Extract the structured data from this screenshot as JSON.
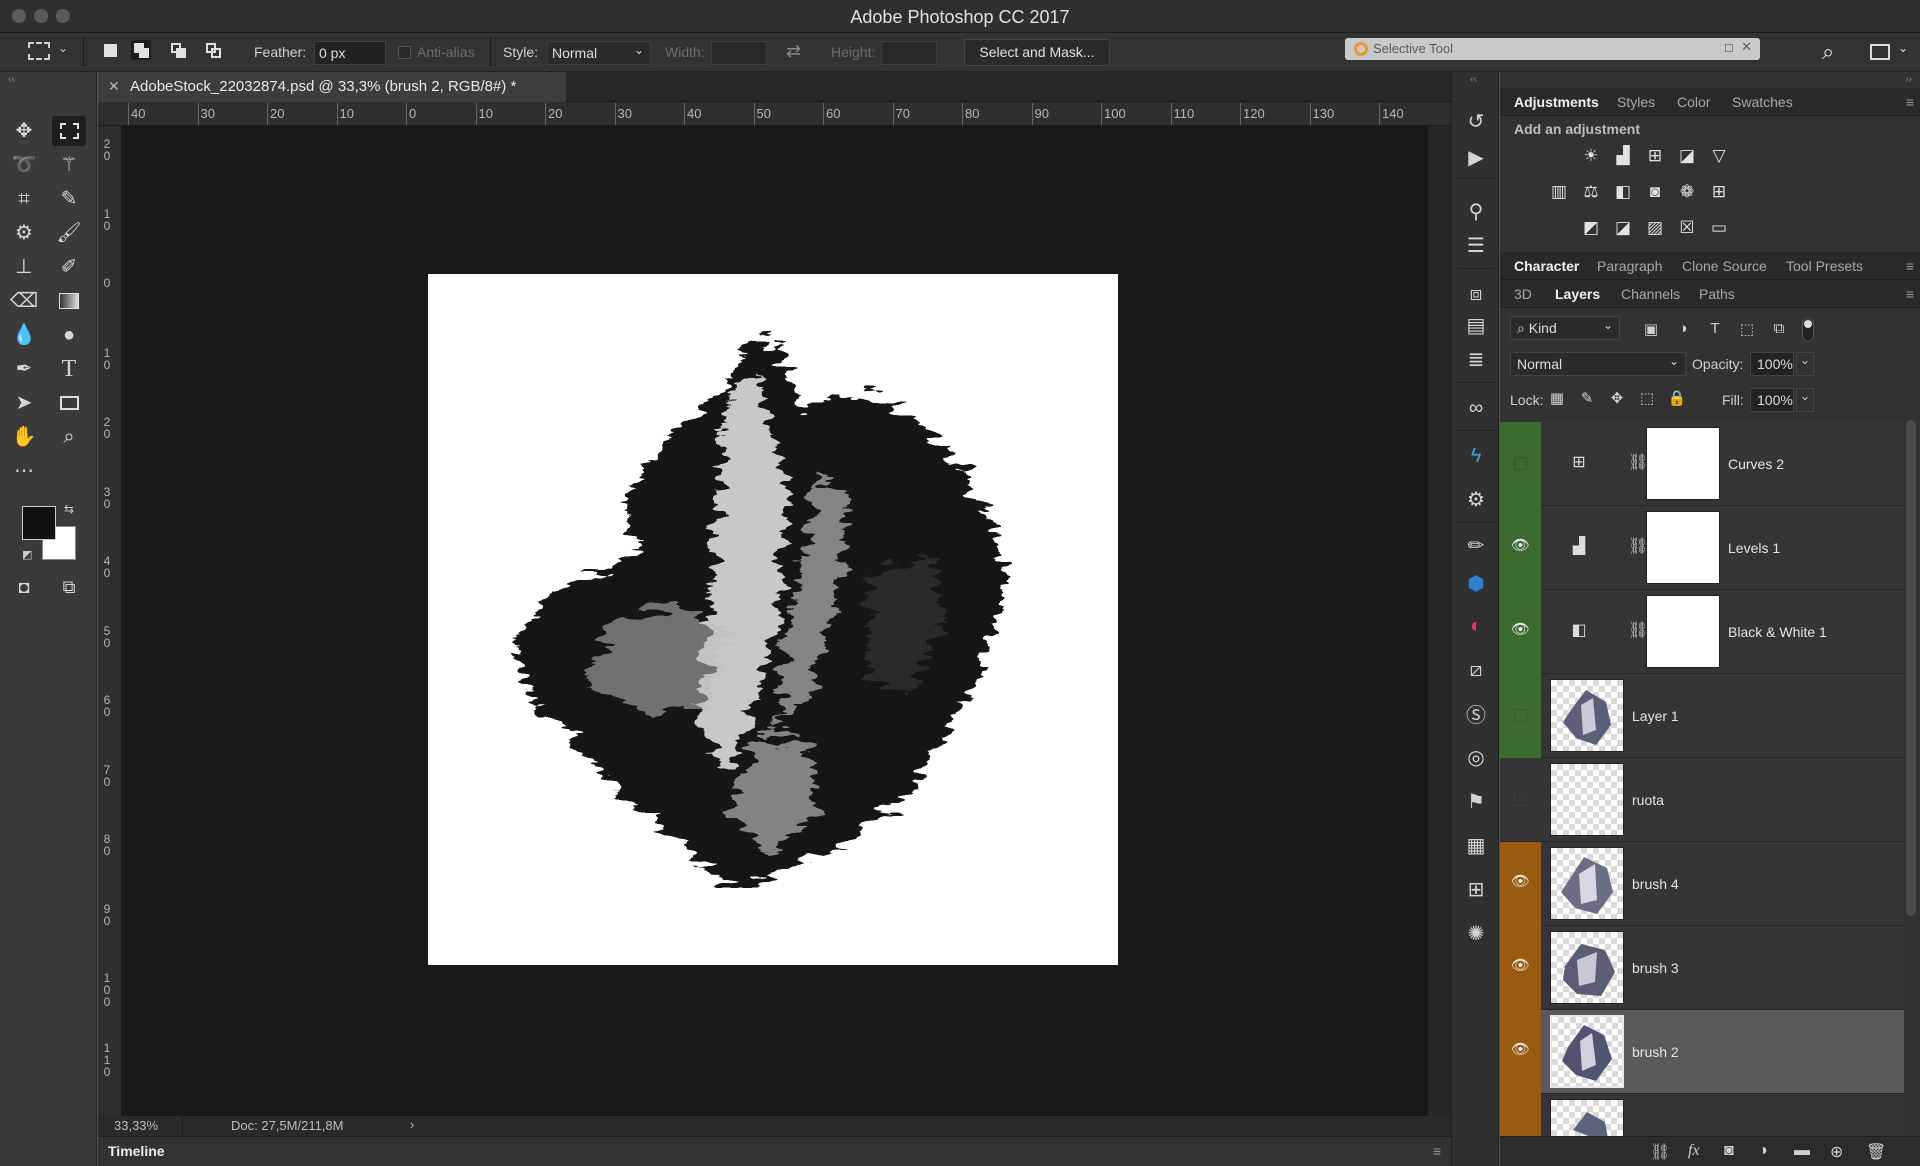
{
  "window": {
    "title": "Adobe Photoshop CC 2017"
  },
  "options_bar": {
    "feather_label": "Feather:",
    "feather_value": "0 px",
    "anti_alias_label": "Anti-alias",
    "style_label": "Style:",
    "style_value": "Normal",
    "width_label": "Width:",
    "height_label": "Height:",
    "select_mask_label": "Select and Mask...",
    "selective_tool_label": "Selective Tool"
  },
  "document": {
    "tab_title": "AdobeStock_22032874.psd @ 33,3% (brush 2, RGB/8#) *",
    "zoom": "33,33%",
    "doc_info": "Doc: 27,5M/211,8M",
    "ruler_top": [
      "40",
      "30",
      "20",
      "10",
      "0",
      "10",
      "20",
      "30",
      "40",
      "50",
      "60",
      "70",
      "80",
      "90",
      "100",
      "110",
      "120",
      "130",
      "140"
    ],
    "ruler_left": [
      "2 0",
      "1 0",
      "0",
      "1 0",
      "2 0",
      "3 0",
      "4 0",
      "5 0",
      "6 0",
      "7 0",
      "8 0",
      "9 0",
      "1 0 0",
      "1 1 0"
    ]
  },
  "timeline": {
    "label": "Timeline"
  },
  "panels": {
    "top_tabs": [
      "Adjustments",
      "Styles",
      "Color",
      "Swatches"
    ],
    "add_adjustment": "Add an adjustment",
    "mid_tabs": [
      "Character",
      "Paragraph",
      "Clone Source",
      "Tool Presets"
    ],
    "layer_tabs": [
      "3D",
      "Layers",
      "Channels",
      "Paths"
    ],
    "filter_kind": "Kind",
    "blend_mode": "Normal",
    "opacity_label": "Opacity:",
    "opacity_value": "100%",
    "lock_label": "Lock:",
    "fill_label": "Fill:",
    "fill_value": "100%"
  },
  "layers": [
    {
      "name": "Curves 2",
      "visible": false,
      "type": "adjustment",
      "color": "#3b6b2e",
      "icon": "curves-icon"
    },
    {
      "name": "Levels 1",
      "visible": true,
      "type": "adjustment",
      "color": "#3b6b2e",
      "icon": "levels-icon"
    },
    {
      "name": "Black & White 1",
      "visible": true,
      "type": "adjustment",
      "color": "#3b6b2e",
      "icon": "black-white-icon"
    },
    {
      "name": "Layer 1",
      "visible": false,
      "type": "pixel",
      "color": "#3b6b2e"
    },
    {
      "name": "ruota",
      "visible": false,
      "type": "pixel",
      "color": ""
    },
    {
      "name": "brush 4",
      "visible": true,
      "type": "pixel",
      "color": "#9a5a10"
    },
    {
      "name": "brush 3",
      "visible": true,
      "type": "pixel",
      "color": "#9a5a10"
    },
    {
      "name": "brush 2",
      "visible": true,
      "type": "pixel",
      "color": "#9a5a10",
      "selected": true
    }
  ]
}
